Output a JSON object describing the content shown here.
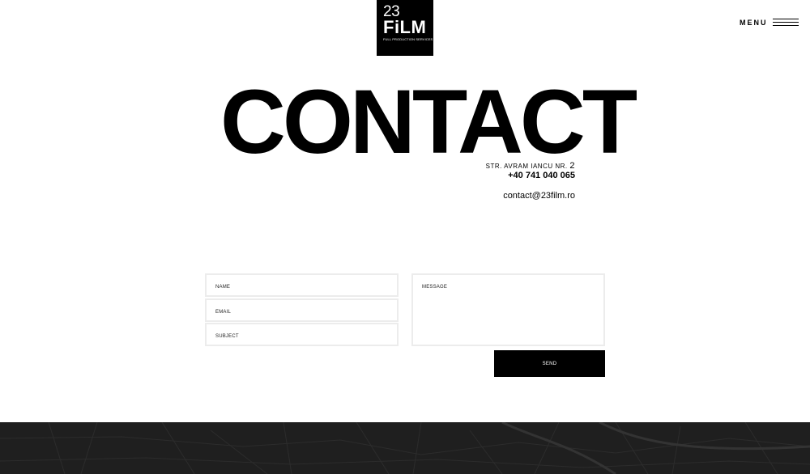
{
  "logo": {
    "number": "23",
    "word": "FiLM",
    "tagline": "FULL PRODUCTION SERVICES"
  },
  "menu": {
    "label": "MENU",
    "icon": "hamburger-icon"
  },
  "heading": "CONTACT",
  "contact": {
    "address_text": "STR. AVRAM IANCU NR.",
    "address_number": "2",
    "phone": "+40 741 040 065",
    "email": "contact@23film.ro"
  },
  "form": {
    "name_placeholder": "NAME",
    "email_placeholder": "EMAIL",
    "subject_placeholder": "SUBJECT",
    "message_placeholder": "MESSAGE",
    "send_label": "SEND"
  },
  "colors": {
    "background": "#ffffff",
    "text": "#000000",
    "field_border": "#ececec",
    "map_background": "#1f1f1f"
  }
}
